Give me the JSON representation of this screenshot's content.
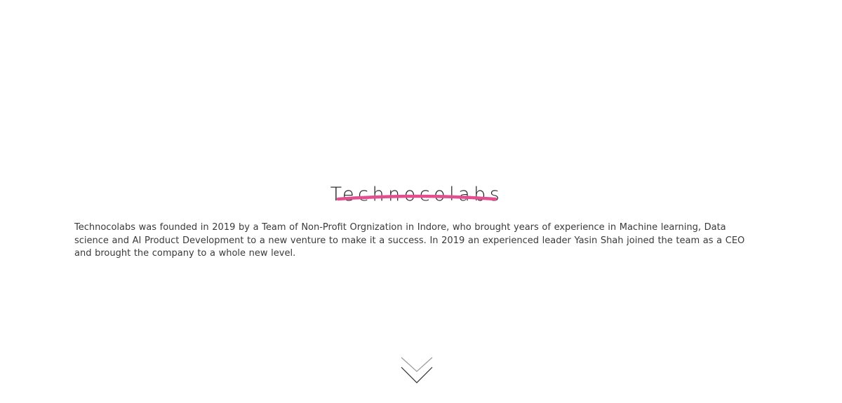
{
  "hero": {
    "title": "Technocolabs",
    "description": "Technocolabs was founded in 2019 by a Team of Non-Profit Orgnization in Indore, who brought years of experience in Machine learning, Data science and AI Product Development to a new venture to make it a success. In 2019 an experienced leader Yasin Shah joined the team as a CEO and brought the company to a whole new level."
  },
  "colors": {
    "accent": "#e24e8e",
    "text": "#3a3a3a",
    "background": "#ffffff"
  },
  "icons": {
    "scroll": "chevron-down-double-icon"
  }
}
